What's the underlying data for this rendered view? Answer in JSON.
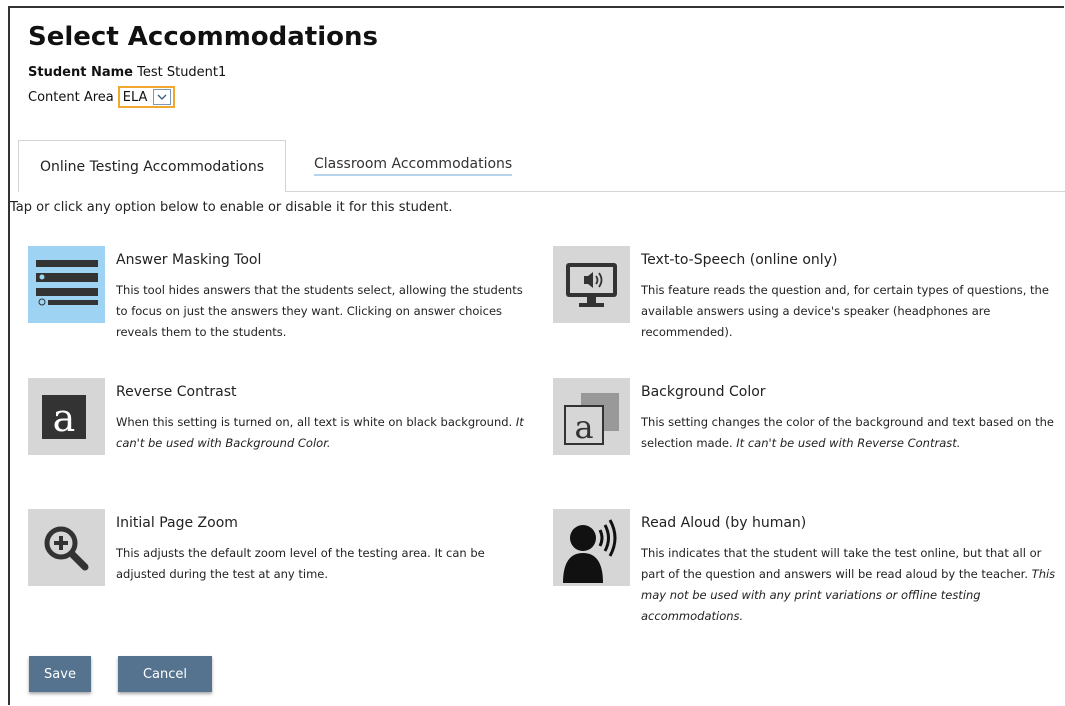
{
  "page": {
    "title": "Select Accommodations",
    "student_name_label": "Student Name",
    "student_name_value": "Test Student1",
    "content_area_label": "Content Area",
    "content_area_value": "ELA"
  },
  "tabs": [
    {
      "label": "Online Testing Accommodations",
      "active": true
    },
    {
      "label": "Classroom Accommodations",
      "active": false
    }
  ],
  "instruction": "Tap or click any option below to enable or disable it for this student.",
  "options": [
    {
      "title": "Answer Masking Tool",
      "desc": "This tool hides answers that the students select, allowing the students to focus on just the answers they want. Clicking on answer choices reveals them to the students.",
      "note": "",
      "icon": "answer-masking-icon",
      "selected": true
    },
    {
      "title": "Text-to-Speech (online only)",
      "desc": "This feature reads the question and, for certain types of questions, the available answers using a device's speaker (headphones are recommended).",
      "note": "",
      "icon": "text-to-speech-icon",
      "selected": false
    },
    {
      "title": "Reverse Contrast",
      "desc": "When this setting is turned on, all text is white on black background.",
      "note": "It can't be used with Background Color.",
      "icon": "reverse-contrast-icon",
      "selected": false
    },
    {
      "title": "Background Color",
      "desc": "This setting changes the color of the background and text based on the selection made.",
      "note": "It can't be used with Reverse Contrast.",
      "icon": "background-color-icon",
      "selected": false
    },
    {
      "title": "Initial Page Zoom",
      "desc": "This adjusts the default zoom level of the testing area. It can be adjusted during the test at any time.",
      "note": "",
      "icon": "zoom-in-icon",
      "selected": false
    },
    {
      "title": "Read Aloud (by human)",
      "desc": "This indicates that the student will take the test online, but that all or part of the question and answers will be read aloud by the teacher.",
      "note": "This may not be used with any print variations or offline testing accommodations.",
      "icon": "read-aloud-icon",
      "selected": false
    }
  ],
  "buttons": {
    "save": "Save",
    "cancel": "Cancel"
  },
  "colors": {
    "accent": "#f0a830",
    "selected_bg": "#9fd3f3",
    "icon_bg": "#d6d6d6",
    "button_bg": "#55738f"
  }
}
